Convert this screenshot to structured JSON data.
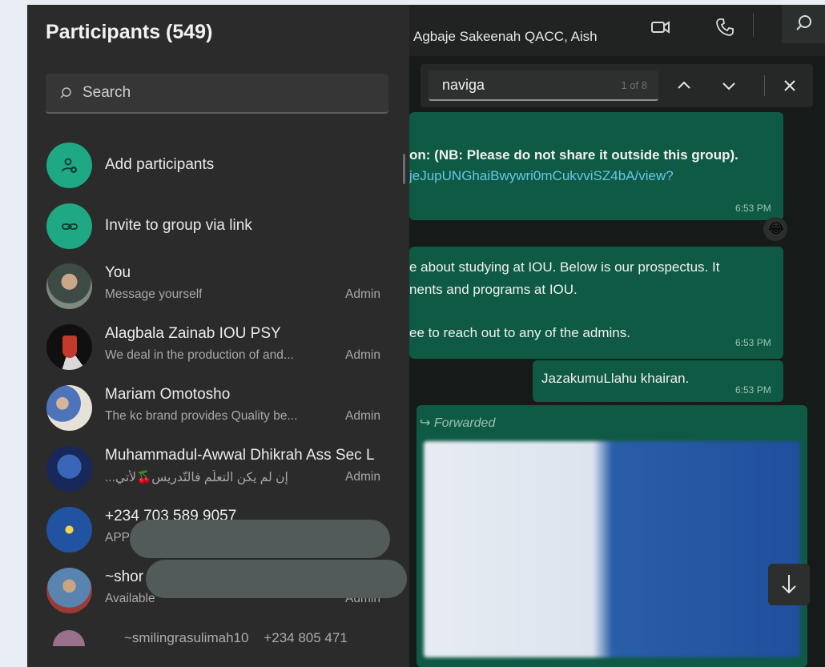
{
  "chat": {
    "title": "Agbaje Sakeenah QACC, Aish",
    "icons": [
      "video-call-icon",
      "voice-call-icon",
      "search-icon"
    ]
  },
  "find": {
    "query": "naviga",
    "count": "1 of 8",
    "icons": [
      "chevron-up-icon",
      "chevron-down-icon",
      "close-icon"
    ]
  },
  "messages": [
    {
      "line1": "on: (NB: Please do not share it outside this group).",
      "link": "jeJupUNGhaiBwywri0mCukvviSZ4bA/view?",
      "time": "6:53 PM",
      "reaction": "😂"
    },
    {
      "line1": "e about studying at IOU. Below is our prospectus. It",
      "line2": "nents and programs at IOU.",
      "line3": "ee to reach out to any of the admins.",
      "time": "6:53 PM"
    },
    {
      "text": "JazakumuLlahu khairan.",
      "time": "6:53 PM"
    },
    {
      "forwarded": "Forwarded"
    }
  ],
  "panel": {
    "title": "Participants (549)",
    "search_placeholder": "Search",
    "actions": [
      {
        "label": "Add participants",
        "icon": "add-person-icon"
      },
      {
        "label": "Invite to group via link",
        "icon": "link-icon"
      }
    ],
    "participants": [
      {
        "name": "You",
        "status": "Message yourself",
        "badge": "Admin"
      },
      {
        "name": "Alagbala Zainab IOU PSY",
        "status": "We deal in the production of and...",
        "badge": "Admin"
      },
      {
        "name": "Mariam Omotosho",
        "status": "The kc brand provides Quality be...",
        "badge": "Admin"
      },
      {
        "name": "Muhammadul-Awwal Dhikrah Ass Sec L",
        "status": "إن لم يكن التعلّم فالتّدريس🍒لأتي...",
        "badge": "Admin"
      },
      {
        "name": "+234 703 589 9057",
        "status": "APP",
        "badge": ""
      },
      {
        "name": "~shor",
        "status": "Available",
        "badge": "Admin"
      }
    ],
    "partial_row": "~smilingrasulimah10    +234 805 471"
  }
}
